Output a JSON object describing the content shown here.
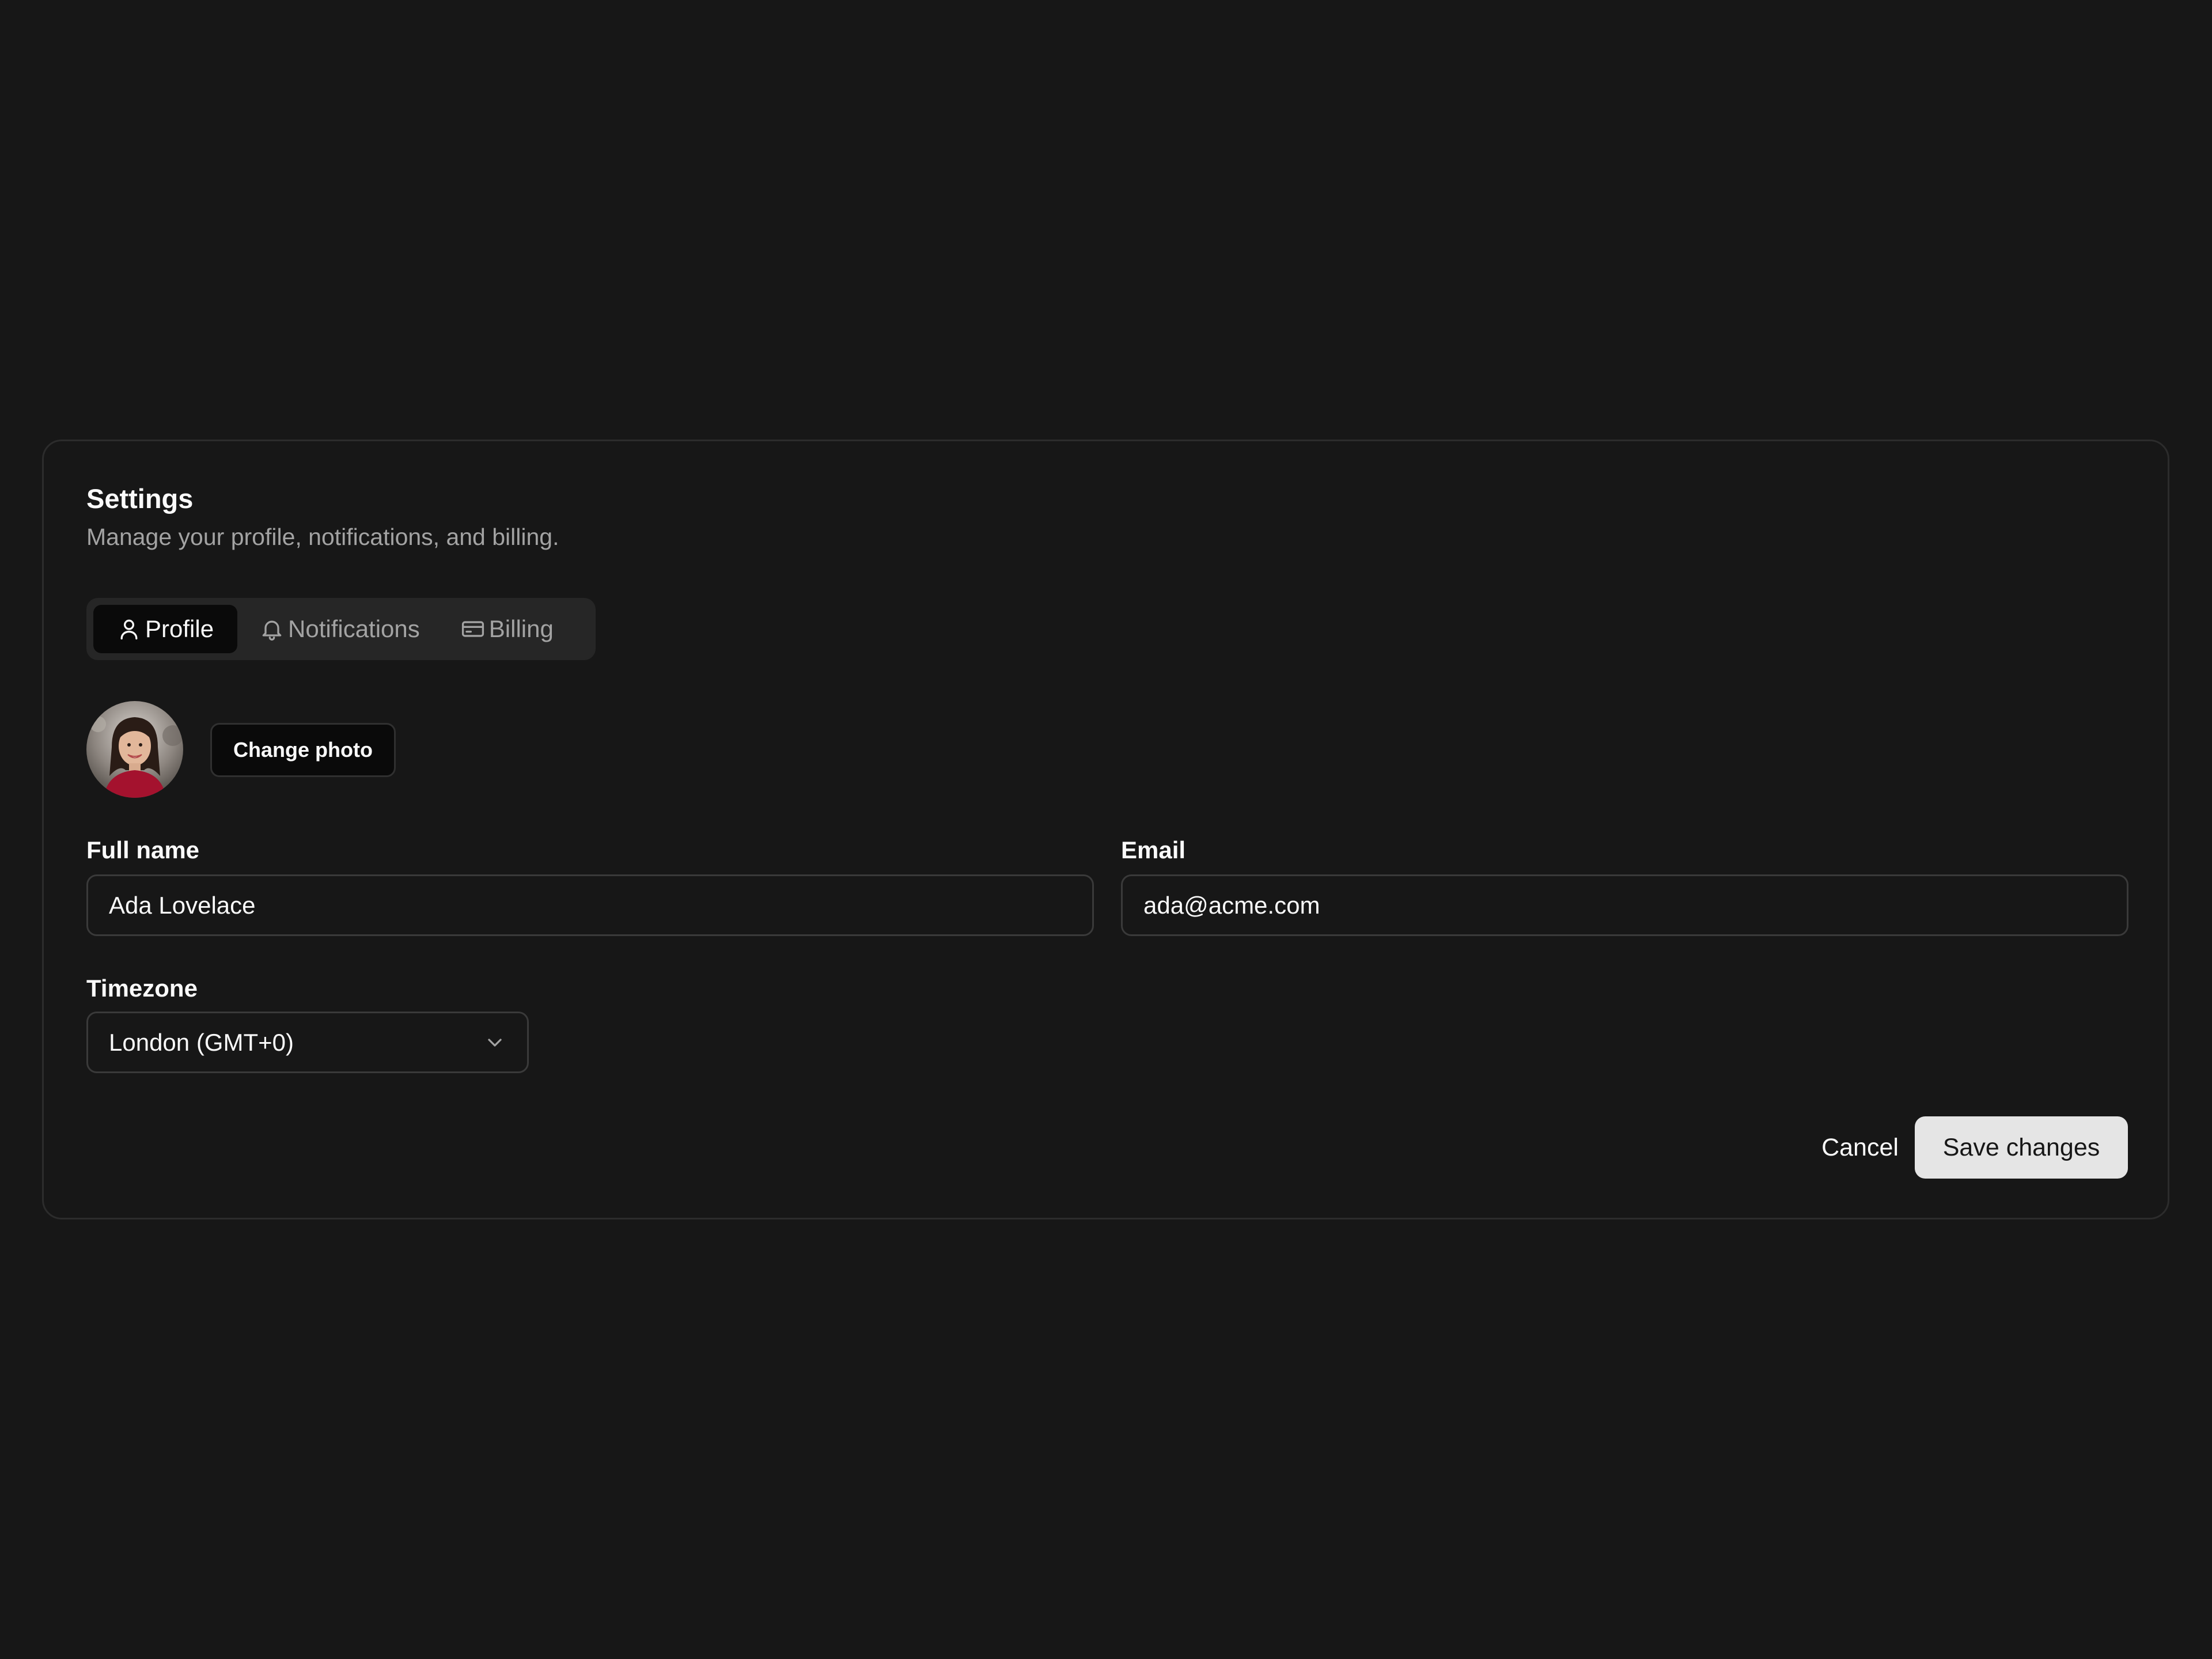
{
  "header": {
    "title": "Settings",
    "subtitle": "Manage your profile, notifications, and billing."
  },
  "tabs": [
    {
      "label": "Profile",
      "icon": "user-icon",
      "active": true
    },
    {
      "label": "Notifications",
      "icon": "bell-icon",
      "active": false
    },
    {
      "label": "Billing",
      "icon": "credit-card-icon",
      "active": false
    }
  ],
  "profile": {
    "avatar_icon": "user-avatar-photo",
    "change_photo_label": "Change photo"
  },
  "form": {
    "full_name": {
      "label": "Full name",
      "value": "Ada Lovelace"
    },
    "email": {
      "label": "Email",
      "value": "ada@acme.com"
    },
    "timezone": {
      "label": "Timezone",
      "value": "London (GMT+0)"
    }
  },
  "actions": {
    "cancel_label": "Cancel",
    "save_label": "Save changes"
  },
  "colors": {
    "background": "#171717",
    "card_border": "#2c2c2c",
    "primary_button": "#e5e5e5",
    "muted_text": "#a3a3a3"
  }
}
